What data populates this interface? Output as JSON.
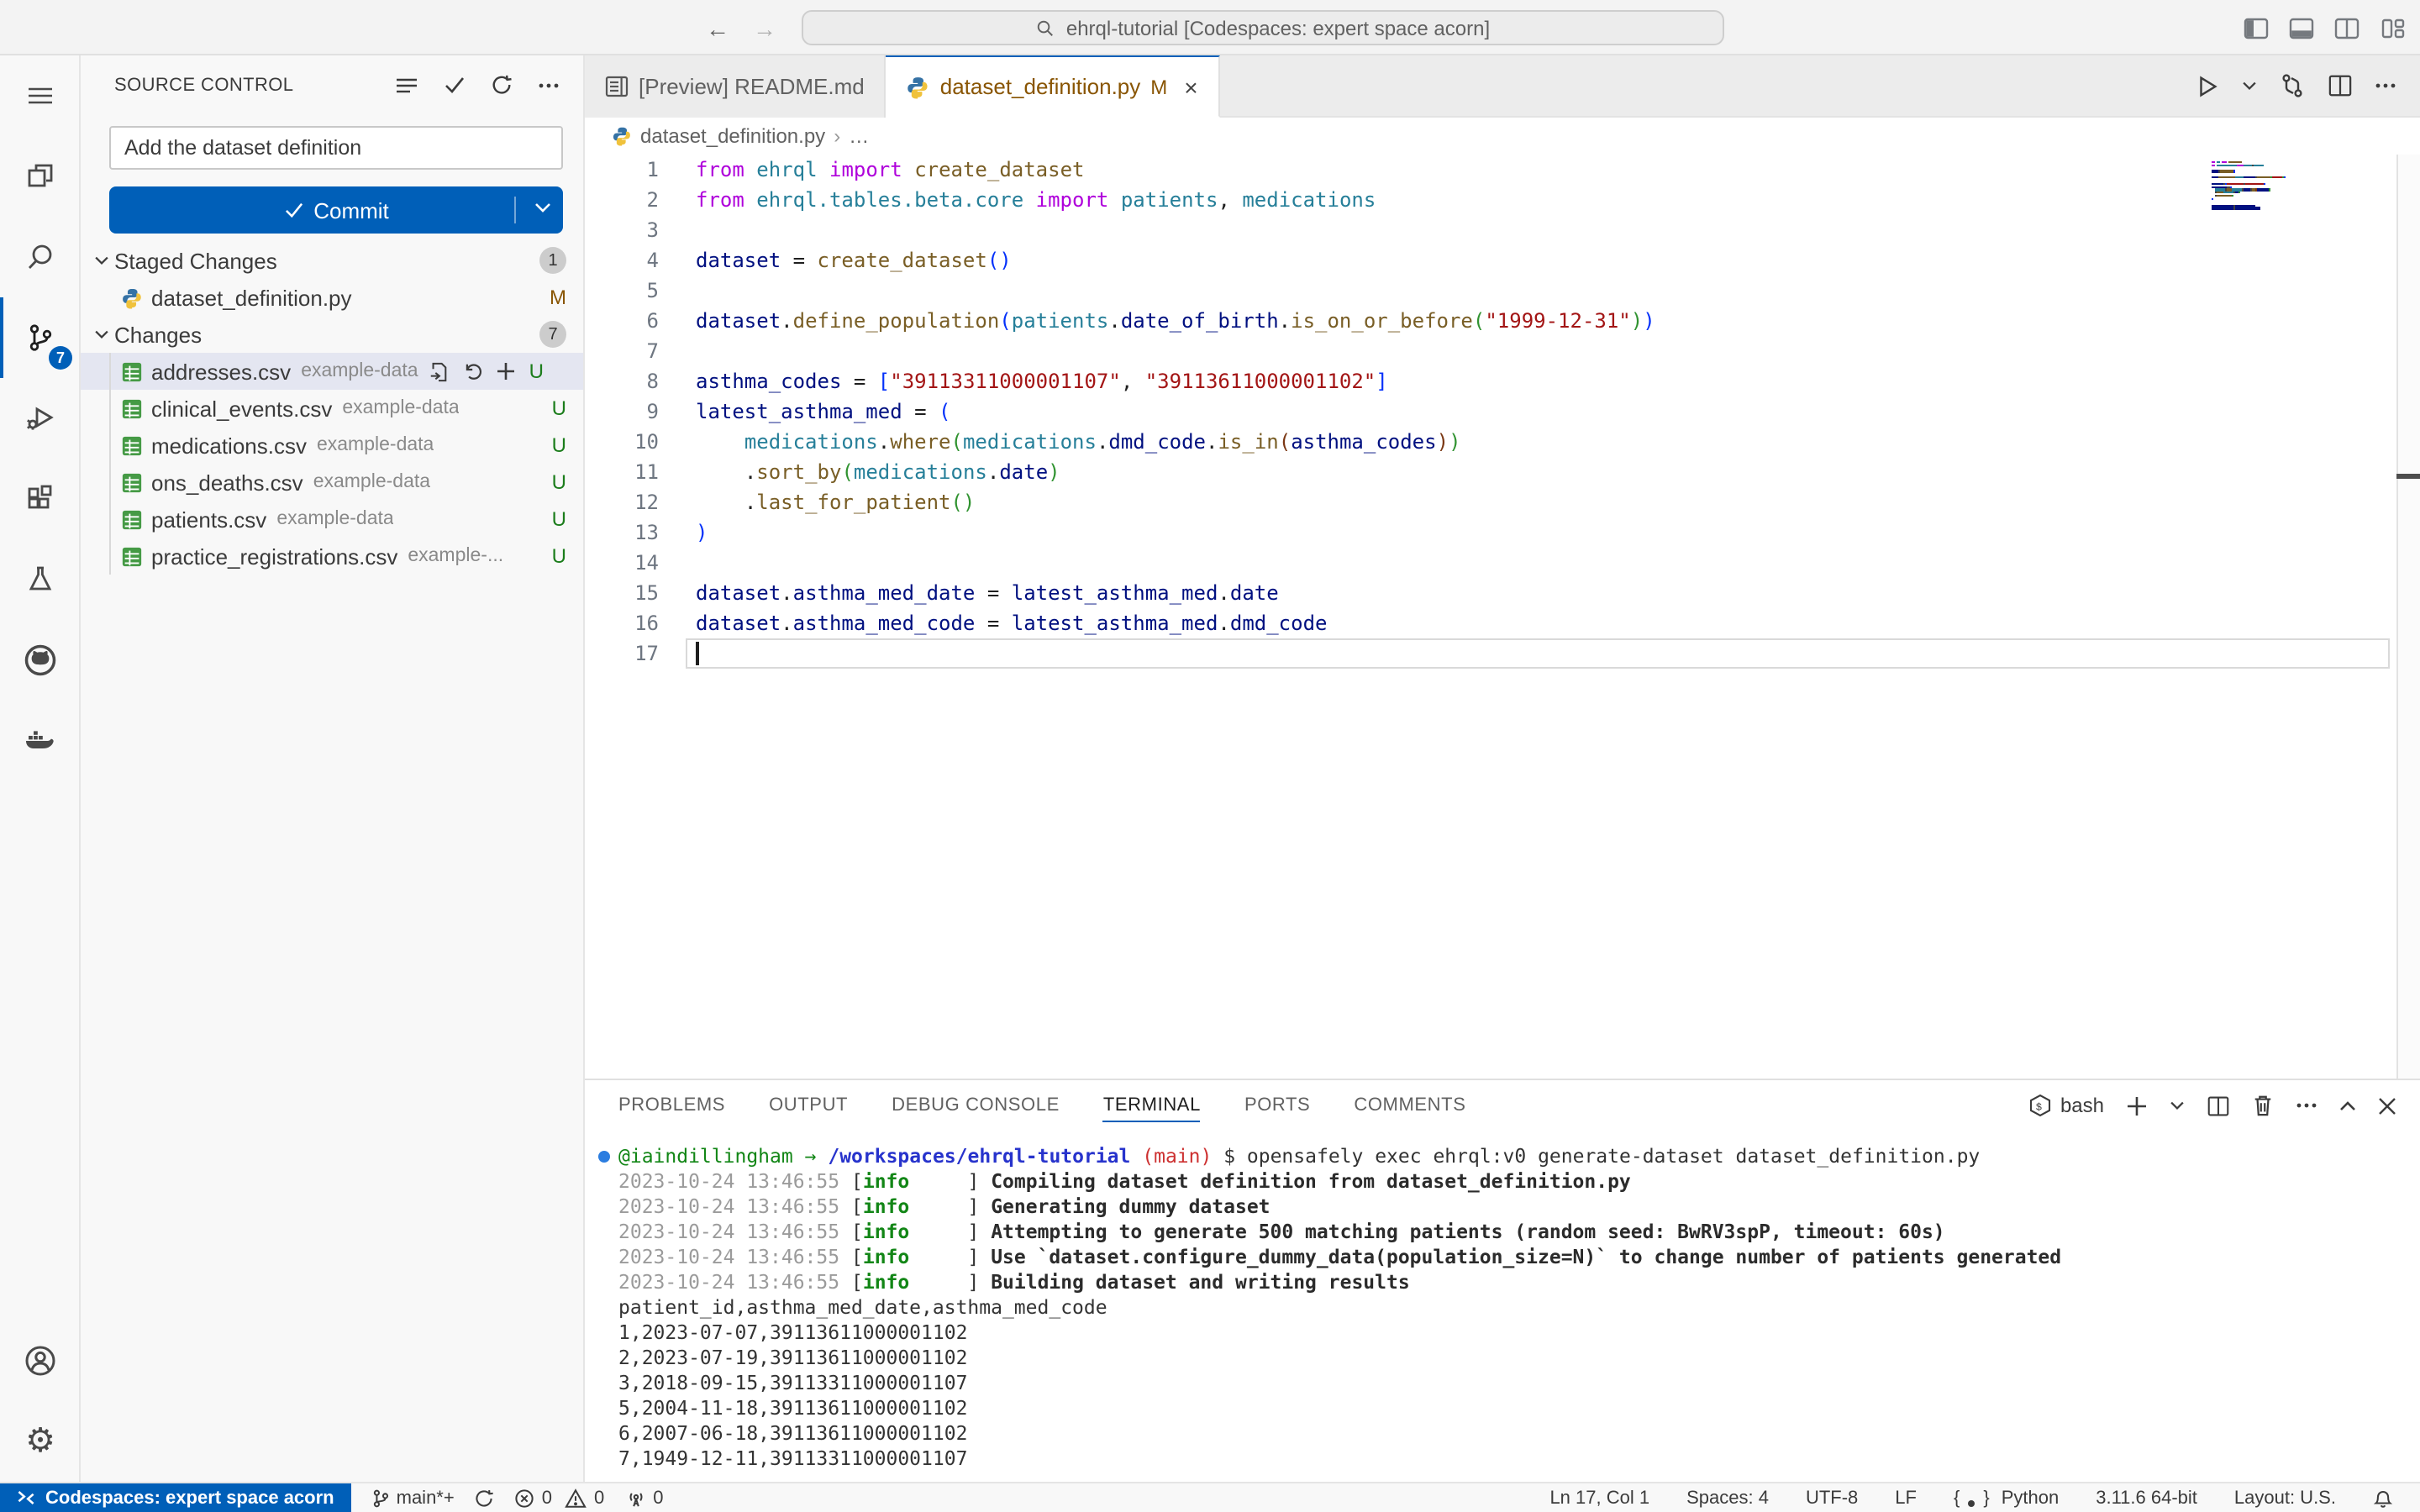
{
  "title_bar": {
    "search_text": "ehrql-tutorial [Codespaces: expert space acorn]"
  },
  "activity_bar": {
    "scm_badge": "7"
  },
  "scm": {
    "title": "SOURCE CONTROL",
    "input_value": "Add the dataset definition",
    "commit_label": "Commit",
    "groups": [
      {
        "label": "Staged Changes",
        "badge": "1",
        "files": [
          {
            "name": "dataset_definition.py",
            "desc": "",
            "status": "M",
            "icon": "python",
            "selected": false,
            "actions": false
          }
        ]
      },
      {
        "label": "Changes",
        "badge": "7",
        "files": [
          {
            "name": "addresses.csv",
            "desc": "example-data",
            "status": "U",
            "icon": "csv",
            "selected": true,
            "actions": true
          },
          {
            "name": "clinical_events.csv",
            "desc": "example-data",
            "status": "U",
            "icon": "csv",
            "selected": false,
            "actions": false
          },
          {
            "name": "medications.csv",
            "desc": "example-data",
            "status": "U",
            "icon": "csv",
            "selected": false,
            "actions": false
          },
          {
            "name": "ons_deaths.csv",
            "desc": "example-data",
            "status": "U",
            "icon": "csv",
            "selected": false,
            "actions": false
          },
          {
            "name": "patients.csv",
            "desc": "example-data",
            "status": "U",
            "icon": "csv",
            "selected": false,
            "actions": false
          },
          {
            "name": "practice_registrations.csv",
            "desc": "example-...",
            "status": "U",
            "icon": "csv",
            "selected": false,
            "actions": false
          }
        ]
      }
    ]
  },
  "tabs": [
    {
      "label": "[Preview] README.md",
      "active": false
    },
    {
      "label": "dataset_definition.py",
      "badge": "M",
      "active": true
    }
  ],
  "breadcrumb": {
    "file": "dataset_definition.py",
    "sep": "›",
    "more": "…"
  },
  "editor": {
    "code_lines": [
      {
        "n": 1,
        "seg": [
          [
            "k",
            "from"
          ],
          [
            "d",
            " "
          ],
          [
            "m",
            "ehrql"
          ],
          [
            "d",
            " "
          ],
          [
            "k",
            "import"
          ],
          [
            "d",
            " "
          ],
          [
            "f",
            "create_dataset"
          ]
        ]
      },
      {
        "n": 2,
        "seg": [
          [
            "k",
            "from"
          ],
          [
            "d",
            " "
          ],
          [
            "m",
            "ehrql.tables.beta.core"
          ],
          [
            "d",
            " "
          ],
          [
            "k",
            "import"
          ],
          [
            "d",
            " "
          ],
          [
            "m",
            "patients"
          ],
          [
            "d",
            ", "
          ],
          [
            "m",
            "medications"
          ]
        ]
      },
      {
        "n": 3,
        "seg": []
      },
      {
        "n": 4,
        "seg": [
          [
            "v",
            "dataset"
          ],
          [
            "d",
            " = "
          ],
          [
            "f",
            "create_dataset"
          ],
          [
            "b1",
            "()"
          ]
        ]
      },
      {
        "n": 5,
        "seg": []
      },
      {
        "n": 6,
        "seg": [
          [
            "v",
            "dataset"
          ],
          [
            "d",
            "."
          ],
          [
            "f",
            "define_population"
          ],
          [
            "b1",
            "("
          ],
          [
            "m",
            "patients"
          ],
          [
            "d",
            "."
          ],
          [
            "v",
            "date_of_birth"
          ],
          [
            "d",
            "."
          ],
          [
            "f",
            "is_on_or_before"
          ],
          [
            "b2",
            "("
          ],
          [
            "s",
            "\"1999-12-31\""
          ],
          [
            "b2",
            ")"
          ],
          [
            "b1",
            ")"
          ]
        ]
      },
      {
        "n": 7,
        "seg": []
      },
      {
        "n": 8,
        "seg": [
          [
            "v",
            "asthma_codes"
          ],
          [
            "d",
            " = "
          ],
          [
            "b1",
            "["
          ],
          [
            "s",
            "\"39113311000001107\""
          ],
          [
            "d",
            ", "
          ],
          [
            "s",
            "\"39113611000001102\""
          ],
          [
            "b1",
            "]"
          ]
        ]
      },
      {
        "n": 9,
        "seg": [
          [
            "v",
            "latest_asthma_med"
          ],
          [
            "d",
            " = "
          ],
          [
            "b1",
            "("
          ]
        ]
      },
      {
        "n": 10,
        "seg": [
          [
            "d",
            "    "
          ],
          [
            "m",
            "medications"
          ],
          [
            "d",
            "."
          ],
          [
            "f",
            "where"
          ],
          [
            "b2",
            "("
          ],
          [
            "m",
            "medications"
          ],
          [
            "d",
            "."
          ],
          [
            "v",
            "dmd_code"
          ],
          [
            "d",
            "."
          ],
          [
            "f",
            "is_in"
          ],
          [
            "b3",
            "("
          ],
          [
            "v",
            "asthma_codes"
          ],
          [
            "b3",
            ")"
          ],
          [
            "b2",
            ")"
          ]
        ]
      },
      {
        "n": 11,
        "seg": [
          [
            "d",
            "    "
          ],
          [
            "d",
            "."
          ],
          [
            "f",
            "sort_by"
          ],
          [
            "b2",
            "("
          ],
          [
            "m",
            "medications"
          ],
          [
            "d",
            "."
          ],
          [
            "v",
            "date"
          ],
          [
            "b2",
            ")"
          ]
        ]
      },
      {
        "n": 12,
        "seg": [
          [
            "d",
            "    "
          ],
          [
            "d",
            "."
          ],
          [
            "f",
            "last_for_patient"
          ],
          [
            "b2",
            "()"
          ]
        ]
      },
      {
        "n": 13,
        "seg": [
          [
            "b1",
            ")"
          ]
        ]
      },
      {
        "n": 14,
        "seg": []
      },
      {
        "n": 15,
        "seg": [
          [
            "v",
            "dataset"
          ],
          [
            "d",
            "."
          ],
          [
            "v",
            "asthma_med_date"
          ],
          [
            "d",
            " = "
          ],
          [
            "v",
            "latest_asthma_med"
          ],
          [
            "d",
            "."
          ],
          [
            "v",
            "date"
          ]
        ]
      },
      {
        "n": 16,
        "seg": [
          [
            "v",
            "dataset"
          ],
          [
            "d",
            "."
          ],
          [
            "v",
            "asthma_med_code"
          ],
          [
            "d",
            " = "
          ],
          [
            "v",
            "latest_asthma_med"
          ],
          [
            "d",
            "."
          ],
          [
            "v",
            "dmd_code"
          ]
        ]
      },
      {
        "n": 17,
        "seg": [],
        "current": true
      }
    ]
  },
  "panel": {
    "tabs": [
      "PROBLEMS",
      "OUTPUT",
      "DEBUG CONSOLE",
      "TERMINAL",
      "PORTS",
      "COMMENTS"
    ],
    "active_tab": "TERMINAL",
    "shell": "bash",
    "terminal_lines": [
      {
        "marker": true,
        "seg": [
          [
            "user",
            "@iaindillingham"
          ],
          [
            "p",
            " "
          ],
          [
            "user",
            "→"
          ],
          [
            "p",
            " "
          ],
          [
            "path",
            "/workspaces/ehrql-tutorial"
          ],
          [
            "p",
            " "
          ],
          [
            "branch",
            "(main)"
          ],
          [
            "p",
            " $ opensafely exec ehrql:v0 generate-dataset dataset_definition.py"
          ]
        ]
      },
      {
        "seg": [
          [
            "ts",
            "2023-10-24 13:46:55 "
          ],
          [
            "p",
            "["
          ],
          [
            "info",
            "info"
          ],
          [
            "p",
            "     ] "
          ],
          [
            "b",
            "Compiling dataset definition from dataset_definition.py"
          ]
        ]
      },
      {
        "seg": [
          [
            "ts",
            "2023-10-24 13:46:55 "
          ],
          [
            "p",
            "["
          ],
          [
            "info",
            "info"
          ],
          [
            "p",
            "     ] "
          ],
          [
            "b",
            "Generating dummy dataset"
          ]
        ]
      },
      {
        "seg": [
          [
            "ts",
            "2023-10-24 13:46:55 "
          ],
          [
            "p",
            "["
          ],
          [
            "info",
            "info"
          ],
          [
            "p",
            "     ] "
          ],
          [
            "b",
            "Attempting to generate 500 matching patients (random seed: BwRV3spP, timeout: 60s)"
          ]
        ]
      },
      {
        "seg": [
          [
            "ts",
            "2023-10-24 13:46:55 "
          ],
          [
            "p",
            "["
          ],
          [
            "info",
            "info"
          ],
          [
            "p",
            "     ] "
          ],
          [
            "b",
            "Use `dataset.configure_dummy_data(population_size=N)` to change number of patients generated"
          ]
        ]
      },
      {
        "seg": [
          [
            "ts",
            "2023-10-24 13:46:55 "
          ],
          [
            "p",
            "["
          ],
          [
            "info",
            "info"
          ],
          [
            "p",
            "     ] "
          ],
          [
            "b",
            "Building dataset and writing results"
          ]
        ]
      },
      {
        "seg": [
          [
            "p",
            "patient_id,asthma_med_date,asthma_med_code"
          ]
        ]
      },
      {
        "seg": [
          [
            "p",
            "1,2023-07-07,39113611000001102"
          ]
        ]
      },
      {
        "seg": [
          [
            "p",
            "2,2023-07-19,39113611000001102"
          ]
        ]
      },
      {
        "seg": [
          [
            "p",
            "3,2018-09-15,39113311000001107"
          ]
        ]
      },
      {
        "seg": [
          [
            "p",
            "5,2004-11-18,39113611000001102"
          ]
        ]
      },
      {
        "seg": [
          [
            "p",
            "6,2007-06-18,39113611000001102"
          ]
        ]
      },
      {
        "seg": [
          [
            "p",
            "7,1949-12-11,39113311000001107"
          ]
        ]
      }
    ]
  },
  "status_bar": {
    "remote": "Codespaces: expert space acorn",
    "branch": "main*+",
    "errors": "0",
    "warnings": "0",
    "ports": "0",
    "line_col": "Ln 17, Col 1",
    "spaces": "Spaces: 4",
    "encoding": "UTF-8",
    "eol": "LF",
    "language": "Python",
    "runtime": "3.11.6 64-bit",
    "layout": "Layout: U.S."
  },
  "colors": {
    "accent": "#005FB8",
    "modified": "#895503",
    "untracked": "#1c7d1c"
  }
}
